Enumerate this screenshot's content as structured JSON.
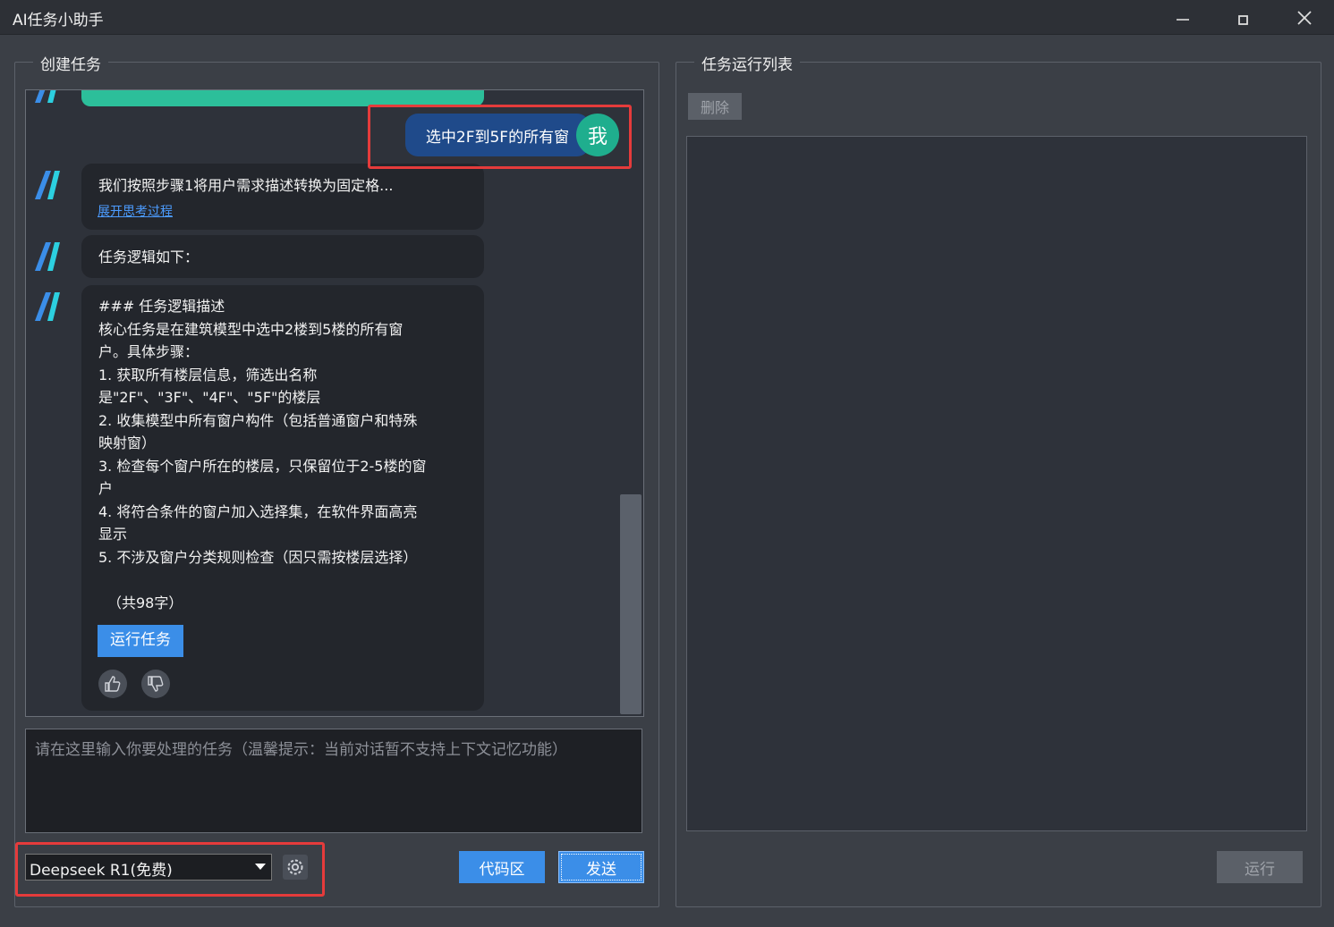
{
  "window": {
    "title": "AI任务小助手",
    "minimize_icon": "minimize-icon",
    "maximize_icon": "maximize-icon",
    "close_icon": "close-icon"
  },
  "create_panel": {
    "label": "创建任务",
    "user_message": "选中2F到5F的所有窗",
    "user_avatar": "我",
    "messages": [
      {
        "text": "我们按照步骤1将用户需求描述转换为固定格...",
        "link": "展开思考过程"
      },
      {
        "text": "任务逻辑如下："
      },
      {
        "lines": [
          "### 任务逻辑描述",
          "核心任务是在建筑模型中选中2楼到5楼的所有窗",
          "户。具体步骤：",
          "1. 获取所有楼层信息，筛选出名称",
          "是\"2F\"、\"3F\"、\"4F\"、\"5F\"的楼层",
          "2. 收集模型中所有窗户构件（包括普通窗户和特殊",
          "映射窗）",
          "3. 检查每个窗户所在的楼层，只保留位于2-5楼的窗",
          "户",
          "4. 将符合条件的窗户加入选择集，在软件界面高亮",
          "显示",
          "5. 不涉及窗户分类规则检查（因只需按楼层选择）",
          "",
          "（共98字）"
        ],
        "run_button": "运行任务"
      }
    ],
    "input_placeholder": "请在这里输入你要处理的任务（温馨提示：当前对话暂不支持上下文记忆功能）",
    "model_selected": "Deepseek R1(免费)",
    "code_button": "代码区",
    "send_button": "发送"
  },
  "run_panel": {
    "label": "任务运行列表",
    "delete_button": "删除",
    "run_button": "运行"
  },
  "colors": {
    "accent_blue": "#3b8ee8",
    "avatar_green": "#1fae8e",
    "highlight_red": "#e53b3b"
  }
}
